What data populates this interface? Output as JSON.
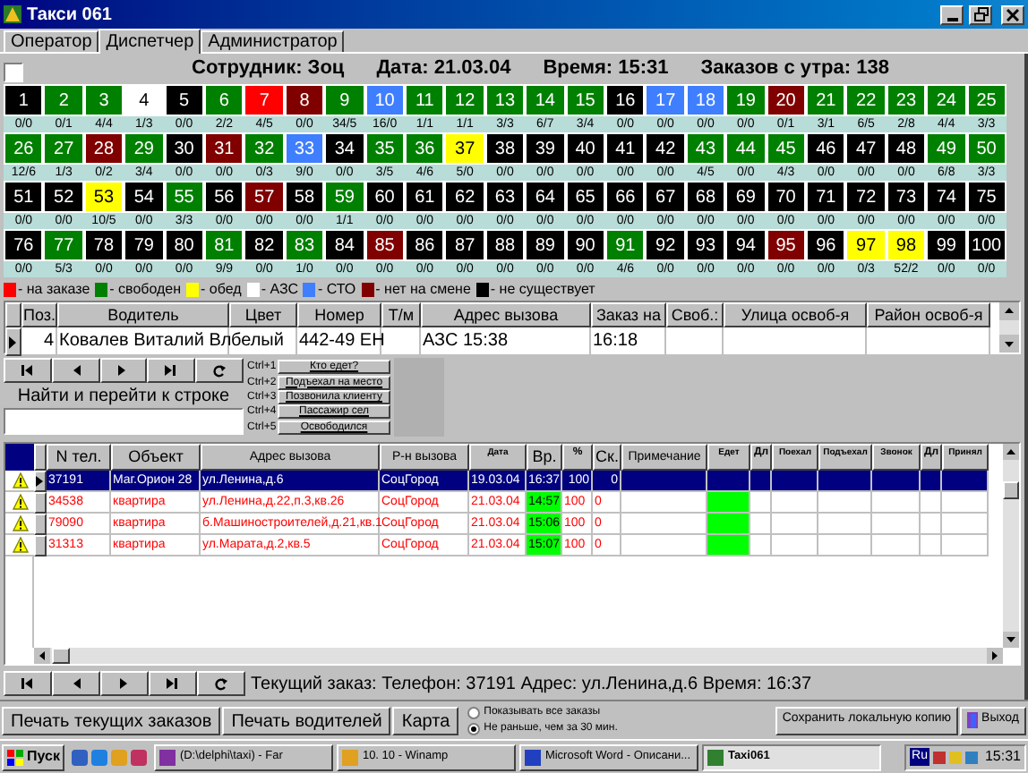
{
  "window": {
    "title": "Такси 061"
  },
  "tabs": [
    {
      "label": "Оператор",
      "selected": false
    },
    {
      "label": "Диспетчер",
      "selected": true
    },
    {
      "label": "Администратор",
      "selected": false
    }
  ],
  "header": {
    "checked": false,
    "fields": [
      "Сотрудник: Зоц",
      "Дата: 21.03.04",
      "Время: 15:31",
      "Заказов с утра: 138"
    ]
  },
  "cars": [
    {
      "number": "1",
      "color": "#000000",
      "orders": "0/0"
    },
    {
      "number": "2",
      "color": "#008000",
      "orders": "0/1"
    },
    {
      "number": "3",
      "color": "#008000",
      "orders": "4/4"
    },
    {
      "number": "4",
      "color": "#ffffff",
      "orders": "1/3"
    },
    {
      "number": "5",
      "color": "#000000",
      "orders": "0/0"
    },
    {
      "number": "6",
      "color": "#008000",
      "orders": "2/2"
    },
    {
      "number": "7",
      "color": "#ff0000",
      "orders": "4/5"
    },
    {
      "number": "8",
      "color": "#800000",
      "orders": "0/0"
    },
    {
      "number": "9",
      "color": "#008000",
      "orders": "34/5"
    },
    {
      "number": "10",
      "color": "#3f7fff",
      "orders": "16/0"
    },
    {
      "number": "11",
      "color": "#008000",
      "orders": "1/1"
    },
    {
      "number": "12",
      "color": "#008000",
      "orders": "1/1"
    },
    {
      "number": "13",
      "color": "#008000",
      "orders": "3/3"
    },
    {
      "number": "14",
      "color": "#008000",
      "orders": "6/7"
    },
    {
      "number": "15",
      "color": "#008000",
      "orders": "3/4"
    },
    {
      "number": "16",
      "color": "#000000",
      "orders": "0/0"
    },
    {
      "number": "17",
      "color": "#3f7fff",
      "orders": "0/0"
    },
    {
      "number": "18",
      "color": "#3f7fff",
      "orders": "0/0"
    },
    {
      "number": "19",
      "color": "#008000",
      "orders": "0/0"
    },
    {
      "number": "20",
      "color": "#800000",
      "orders": "0/1"
    },
    {
      "number": "21",
      "color": "#008000",
      "orders": "3/1"
    },
    {
      "number": "22",
      "color": "#008000",
      "orders": "6/5"
    },
    {
      "number": "23",
      "color": "#008000",
      "orders": "2/8"
    },
    {
      "number": "24",
      "color": "#008000",
      "orders": "4/4"
    },
    {
      "number": "25",
      "color": "#008000",
      "orders": "3/3"
    },
    {
      "number": "26",
      "color": "#008000",
      "orders": "12/6"
    },
    {
      "number": "27",
      "color": "#008000",
      "orders": "1/3"
    },
    {
      "number": "28",
      "color": "#800000",
      "orders": "0/2"
    },
    {
      "number": "29",
      "color": "#008000",
      "orders": "3/4"
    },
    {
      "number": "30",
      "color": "#000000",
      "orders": "0/0"
    },
    {
      "number": "31",
      "color": "#800000",
      "orders": "0/0"
    },
    {
      "number": "32",
      "color": "#008000",
      "orders": "0/3"
    },
    {
      "number": "33",
      "color": "#3f7fff",
      "orders": "9/0"
    },
    {
      "number": "34",
      "color": "#000000",
      "orders": "0/0"
    },
    {
      "number": "35",
      "color": "#008000",
      "orders": "3/5"
    },
    {
      "number": "36",
      "color": "#008000",
      "orders": "4/6"
    },
    {
      "number": "37",
      "color": "#ffff00",
      "orders": "5/0"
    },
    {
      "number": "38",
      "color": "#000000",
      "orders": "0/0"
    },
    {
      "number": "39",
      "color": "#000000",
      "orders": "0/0"
    },
    {
      "number": "40",
      "color": "#000000",
      "orders": "0/0"
    },
    {
      "number": "41",
      "color": "#000000",
      "orders": "0/0"
    },
    {
      "number": "42",
      "color": "#000000",
      "orders": "0/0"
    },
    {
      "number": "43",
      "color": "#008000",
      "orders": "4/5"
    },
    {
      "number": "44",
      "color": "#008000",
      "orders": "0/0"
    },
    {
      "number": "45",
      "color": "#008000",
      "orders": "4/3"
    },
    {
      "number": "46",
      "color": "#000000",
      "orders": "0/0"
    },
    {
      "number": "47",
      "color": "#000000",
      "orders": "0/0"
    },
    {
      "number": "48",
      "color": "#000000",
      "orders": "0/0"
    },
    {
      "number": "49",
      "color": "#008000",
      "orders": "6/8"
    },
    {
      "number": "50",
      "color": "#008000",
      "orders": "3/3"
    },
    {
      "number": "51",
      "color": "#000000",
      "orders": "0/0"
    },
    {
      "number": "52",
      "color": "#000000",
      "orders": "0/0"
    },
    {
      "number": "53",
      "color": "#ffff00",
      "orders": "10/5"
    },
    {
      "number": "54",
      "color": "#000000",
      "orders": "0/0"
    },
    {
      "number": "55",
      "color": "#008000",
      "orders": "3/3"
    },
    {
      "number": "56",
      "color": "#000000",
      "orders": "0/0"
    },
    {
      "number": "57",
      "color": "#800000",
      "orders": "0/0"
    },
    {
      "number": "58",
      "color": "#000000",
      "orders": "0/0"
    },
    {
      "number": "59",
      "color": "#008000",
      "orders": "1/1"
    },
    {
      "number": "60",
      "color": "#000000",
      "orders": "0/0"
    },
    {
      "number": "61",
      "color": "#000000",
      "orders": "0/0"
    },
    {
      "number": "62",
      "color": "#000000",
      "orders": "0/0"
    },
    {
      "number": "63",
      "color": "#000000",
      "orders": "0/0"
    },
    {
      "number": "64",
      "color": "#000000",
      "orders": "0/0"
    },
    {
      "number": "65",
      "color": "#000000",
      "orders": "0/0"
    },
    {
      "number": "66",
      "color": "#000000",
      "orders": "0/0"
    },
    {
      "number": "67",
      "color": "#000000",
      "orders": "0/0"
    },
    {
      "number": "68",
      "color": "#000000",
      "orders": "0/0"
    },
    {
      "number": "69",
      "color": "#000000",
      "orders": "0/0"
    },
    {
      "number": "70",
      "color": "#000000",
      "orders": "0/0"
    },
    {
      "number": "71",
      "color": "#000000",
      "orders": "0/0"
    },
    {
      "number": "72",
      "color": "#000000",
      "orders": "0/0"
    },
    {
      "number": "73",
      "color": "#000000",
      "orders": "0/0"
    },
    {
      "number": "74",
      "color": "#000000",
      "orders": "0/0"
    },
    {
      "number": "75",
      "color": "#000000",
      "orders": "0/0"
    },
    {
      "number": "76",
      "color": "#000000",
      "orders": "0/0"
    },
    {
      "number": "77",
      "color": "#008000",
      "orders": "5/3"
    },
    {
      "number": "78",
      "color": "#000000",
      "orders": "0/0"
    },
    {
      "number": "79",
      "color": "#000000",
      "orders": "0/0"
    },
    {
      "number": "80",
      "color": "#000000",
      "orders": "0/0"
    },
    {
      "number": "81",
      "color": "#008000",
      "orders": "9/9"
    },
    {
      "number": "82",
      "color": "#000000",
      "orders": "0/0"
    },
    {
      "number": "83",
      "color": "#008000",
      "orders": "1/0"
    },
    {
      "number": "84",
      "color": "#000000",
      "orders": "0/0"
    },
    {
      "number": "85",
      "color": "#800000",
      "orders": "0/0"
    },
    {
      "number": "86",
      "color": "#000000",
      "orders": "0/0"
    },
    {
      "number": "87",
      "color": "#000000",
      "orders": "0/0"
    },
    {
      "number": "88",
      "color": "#000000",
      "orders": "0/0"
    },
    {
      "number": "89",
      "color": "#000000",
      "orders": "0/0"
    },
    {
      "number": "90",
      "color": "#000000",
      "orders": "0/0"
    },
    {
      "number": "91",
      "color": "#008000",
      "orders": "4/6"
    },
    {
      "number": "92",
      "color": "#000000",
      "orders": "0/0"
    },
    {
      "number": "93",
      "color": "#000000",
      "orders": "0/0"
    },
    {
      "number": "94",
      "color": "#000000",
      "orders": "0/0"
    },
    {
      "number": "95",
      "color": "#800000",
      "orders": "0/0"
    },
    {
      "number": "96",
      "color": "#000000",
      "orders": "0/0"
    },
    {
      "number": "97",
      "color": "#ffff00",
      "orders": "0/3"
    },
    {
      "number": "98",
      "color": "#ffff00",
      "orders": "52/2"
    },
    {
      "number": "99",
      "color": "#000000",
      "orders": "0/0"
    },
    {
      "number": "100",
      "color": "#000000",
      "orders": "0/0"
    }
  ],
  "legend": [
    {
      "color": "#ff0000",
      "label": "- на заказе"
    },
    {
      "color": "#008000",
      "label": "- свободен"
    },
    {
      "color": "#ffff00",
      "label": "- обед"
    },
    {
      "color": "#ffffff",
      "label": "- АЗС"
    },
    {
      "color": "#3f7fff",
      "label": "- СТО"
    },
    {
      "color": "#800000",
      "label": "- нет на смене"
    },
    {
      "color": "#000000",
      "label": "- не существует"
    }
  ],
  "drivers": {
    "columns": [
      "Поз.",
      "Водитель",
      "Цвет",
      "Номер",
      "Т/м",
      "Адрес вызова",
      "Заказ на",
      "Своб.:",
      "Улица освоб-я",
      "Район освоб-я"
    ],
    "rows": [
      {
        "selected": true,
        "cells": [
          "4",
          "Ковалев Виталий Вл",
          "белый",
          "442-49 ЕН",
          "",
          "АЗС 15:38",
          "16:18",
          "",
          "",
          ""
        ]
      }
    ]
  },
  "find": {
    "label": "Найти и перейти к строке"
  },
  "hotkeys": [
    {
      "key": "Ctrl+1",
      "label": "Кто едет?"
    },
    {
      "key": "Ctrl+2",
      "label": "Подъехал на место"
    },
    {
      "key": "Ctrl+3",
      "label": "Позвонила клиенту"
    },
    {
      "key": "Ctrl+4",
      "label": "Пассажир сел"
    },
    {
      "key": "Ctrl+5",
      "label": "Освободился"
    }
  ],
  "orders": {
    "columns": [
      "N тел.",
      "Объект",
      "Адрес вызова",
      "Р-н вызова",
      "Дата",
      "Вр.",
      "%",
      "Ск.",
      "Примечание",
      "Едет",
      "Дл",
      "Поехал",
      "Подъехал",
      "Звонок",
      "Дл",
      "Принял"
    ],
    "rows": [
      {
        "selected": true,
        "on_way": false,
        "cells": [
          "37191",
          "Маг.Орион 28",
          "ул.Ленина,д.6",
          "СоцГород",
          "19.03.04",
          "16:37",
          "100",
          "0",
          "",
          "",
          "",
          "",
          "",
          "",
          "",
          ""
        ]
      },
      {
        "selected": false,
        "on_way": true,
        "cells": [
          "34538",
          "квартира",
          "ул.Ленина,д.22,п.3,кв.26",
          "СоцГород",
          "21.03.04",
          "14:57",
          "100",
          "0",
          "",
          "",
          "",
          "",
          "",
          "",
          "",
          ""
        ]
      },
      {
        "selected": false,
        "on_way": true,
        "cells": [
          "79090",
          "квартира",
          "б.Машиностроителей,д.21,кв.1",
          "СоцГород",
          "21.03.04",
          "15:06",
          "100",
          "0",
          "",
          "",
          "",
          "",
          "",
          "",
          "",
          ""
        ]
      },
      {
        "selected": false,
        "on_way": true,
        "cells": [
          "31313",
          "квартира",
          "ул.Марата,д.2,кв.5",
          "СоцГород",
          "21.03.04",
          "15:07",
          "100",
          "0",
          "",
          "",
          "",
          "",
          "",
          "",
          "",
          ""
        ]
      }
    ]
  },
  "current_order": "Текущий заказ: Телефон: 37191 Адрес: ул.Ленина,д.6 Время: 16:37",
  "buttons": [
    "Печать текущих заказов",
    "Печать водителей",
    "Карта"
  ],
  "filter": [
    {
      "label": "Показывать все заказы",
      "selected": false
    },
    {
      "label": "Не раньше, чем за 30 мин.",
      "selected": true
    }
  ],
  "right_buttons": [
    "Сохранить локальную копию",
    "Выход"
  ],
  "taskbar": {
    "start": "Пуск",
    "tasks": [
      {
        "label": "(D:\\delphi\\taxi) - Far",
        "selected": false
      },
      {
        "label": "10. 10 - Winamp",
        "selected": false
      },
      {
        "label": "Microsoft Word - Описани...",
        "selected": false
      },
      {
        "label": "Taxi061",
        "selected": true
      }
    ],
    "lang": "Ru",
    "clock": "15:31"
  }
}
